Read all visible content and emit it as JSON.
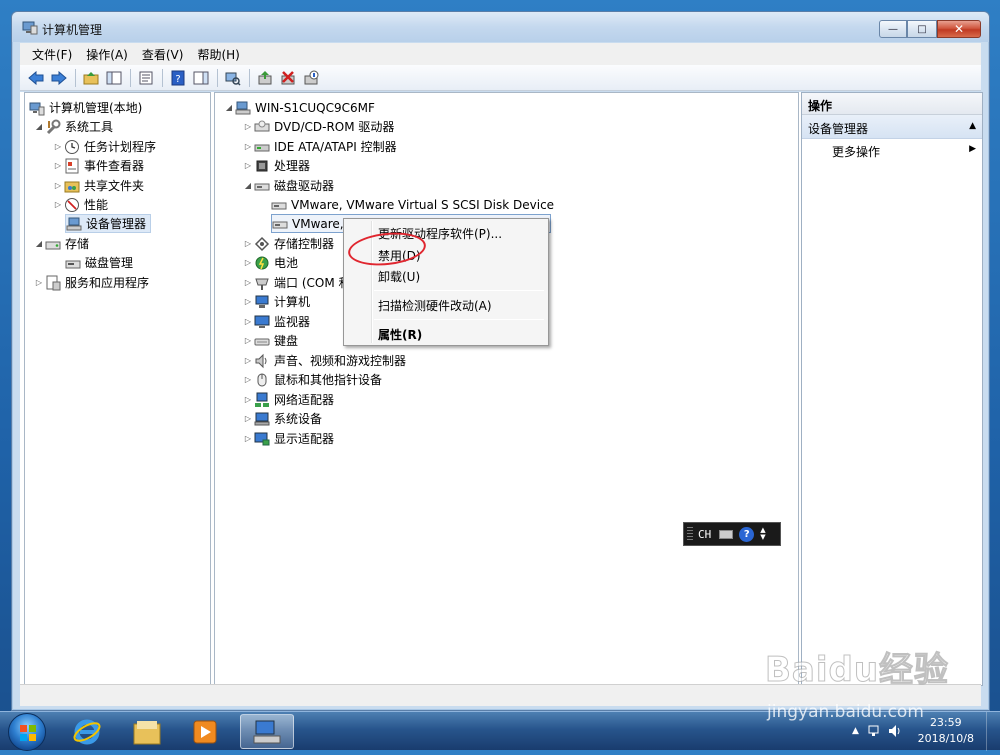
{
  "window": {
    "title": "计算机管理",
    "min_label": "—",
    "max_label": "□",
    "close_label": "✕"
  },
  "menubar": {
    "items": [
      "文件(F)",
      "操作(A)",
      "查看(V)",
      "帮助(H)"
    ]
  },
  "left_tree": {
    "root": "计算机管理(本地)",
    "system_tools": "系统工具",
    "task_scheduler": "任务计划程序",
    "event_viewer": "事件查看器",
    "shared_folders": "共享文件夹",
    "performance": "性能",
    "device_manager": "设备管理器",
    "storage": "存储",
    "disk_management": "磁盘管理",
    "services_apps": "服务和应用程序"
  },
  "device_tree": {
    "host": "WIN-S1CUQC9C6MF",
    "dvd": "DVD/CD-ROM 驱动器",
    "ide": "IDE ATA/ATAPI 控制器",
    "processor": "处理器",
    "disk_drives": "磁盘驱动器",
    "disk1": "VMware, VMware Virtual S SCSI Disk Device",
    "disk2": "VMware,",
    "storage_ctrl": "存储控制器",
    "battery": "电池",
    "ports": "端口 (COM 和",
    "computer": "计算机",
    "monitors": "监视器",
    "keyboards": "键盘",
    "sound": "声音、视频和游戏控制器",
    "mice": "鼠标和其他指针设备",
    "network": "网络适配器",
    "system_devices": "系统设备",
    "display": "显示适配器"
  },
  "context_menu": {
    "update_driver": "更新驱动程序软件(P)...",
    "disable": "禁用(D)",
    "uninstall": "卸载(U)",
    "scan": "扫描检测硬件改动(A)",
    "properties": "属性(R)"
  },
  "actions": {
    "header": "操作",
    "section": "设备管理器",
    "more": "更多操作"
  },
  "ime": {
    "label": "CH",
    "help": "?"
  },
  "taskbar": {
    "time": "23:59",
    "date": "2018/10/8"
  },
  "watermark": {
    "logo": "Baidu经验",
    "url": "jingyan.baidu.com"
  }
}
